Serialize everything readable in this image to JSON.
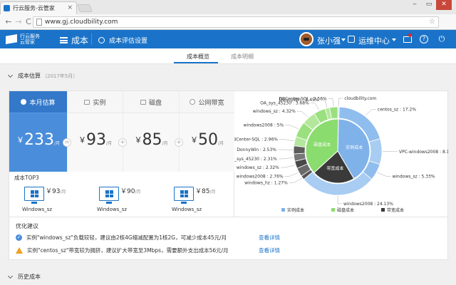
{
  "browser": {
    "tab_title": "行云服务-云管家",
    "tab_close": "×",
    "url": "www.gj.cloudbility.com",
    "back": "←",
    "forward": "→",
    "reload": "C",
    "star": "☆",
    "win_min": "‒",
    "win_max": "▭",
    "win_close": "✕"
  },
  "header": {
    "logo_line1": "行云服务",
    "logo_line2": "云管家",
    "menu_label": "成本",
    "settings_label": "成本评估设置",
    "user_name": "张小强",
    "ops_label": "运维中心",
    "help": "?",
    "power": "⏻"
  },
  "subnav": {
    "tabs": [
      {
        "label": "成本概览",
        "active": true
      },
      {
        "label": "成本明细",
        "active": false
      }
    ]
  },
  "estimate": {
    "section_title": "成本估算",
    "section_year": "（2017年5月）",
    "currency": "￥",
    "unit": "/月",
    "columns": [
      {
        "label": "本月估算",
        "value": "233"
      },
      {
        "label": "实例",
        "value": "93"
      },
      {
        "label": "磁盘",
        "value": "85"
      },
      {
        "label": "公网带宽",
        "value": "50"
      }
    ],
    "ops": [
      "=",
      "+",
      "+"
    ],
    "top3_label": "成本TOP3",
    "top3": [
      {
        "price": "93",
        "name": "Windows_sz"
      },
      {
        "price": "90",
        "name": "Windows_sz"
      },
      {
        "price": "85",
        "name": "Windows_sz"
      }
    ]
  },
  "chart_data": {
    "type": "pie",
    "inner": [
      {
        "name": "实例成本",
        "value": 40
      },
      {
        "name": "磁盘成本",
        "value": 36
      },
      {
        "name": "带宽成本",
        "value": 21
      }
    ],
    "outer": [
      {
        "label": "cloudbility.com",
        "value": 0.5
      },
      {
        "label": "centos_sz : 17.2%",
        "value": 17.2
      },
      {
        "label": "VPC-windows2008 : 8.11%",
        "value": 8.11
      },
      {
        "label": "windows_sz : 5.33%",
        "value": 5.33
      },
      {
        "label": "windows2008 : 24.13%",
        "value": 24.13
      },
      {
        "label": "windows_hz : 1.27%",
        "value": 1.27
      },
      {
        "label": "windows2008 : 2.76%",
        "value": 2.76
      },
      {
        "label": "windows_sz : 2.32%",
        "value": 2.32
      },
      {
        "label": "OA_sys_45230 : 2.31%",
        "value": 2.31
      },
      {
        "label": "DonnyWin : 2.53%",
        "value": 2.53
      },
      {
        "label": "DBCenter-SQL : 2.96%",
        "value": 2.96
      },
      {
        "label": "windows2008 : 5%",
        "value": 5
      },
      {
        "label": "windows_sz : 4.32%",
        "value": 4.32
      },
      {
        "label": "OA_sys_45230 : 3.68%",
        "value": 3.68
      },
      {
        "label": "DonnyWin : 1.45%",
        "value": 1.45
      },
      {
        "label": "DBCenter-SQL : 2.56%",
        "value": 2.56
      }
    ],
    "legend": [
      "实例成本",
      "磁盘成本",
      "带宽成本"
    ],
    "colors": {
      "instance": "#7fb2e8",
      "disk": "#8bdc6e",
      "bandwidth": "#3a3a3a"
    }
  },
  "suggestions": {
    "title": "优化建议",
    "items": [
      {
        "text": "实例\"windows_sz\"负载较轻，建议由2核4G缩减配置为1核2G，可减少成本45元/月",
        "link": "查看详情",
        "icon": "✓"
      },
      {
        "text": "实例\"centos_sz\"带宽较为拥挤，建议扩大带宽至3Mbps，需要额外支出成本56元/月",
        "link": "查看详情",
        "icon": "!"
      }
    ]
  },
  "history": {
    "title": "历史成本"
  }
}
